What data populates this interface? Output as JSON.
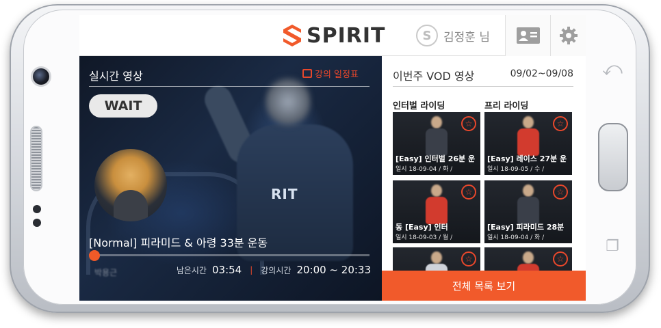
{
  "header": {
    "logo_text": "SPIRIT",
    "user_name": "김정훈 님",
    "accent_color": "#f15a2b",
    "icons": [
      "spirit-logo-icon",
      "user-avatar-icon",
      "id-card-icon",
      "gear-icon"
    ]
  },
  "live": {
    "title": "실시간 영상",
    "schedule_link": "강의 일정표",
    "status_badge": "WAIT",
    "program_title": "[Normal] 피라미드 & 아령 33분 운동",
    "progress_fraction": 0.02,
    "caption": "박용근",
    "remaining_label": "남은시간",
    "remaining_value": "03:54",
    "separator": "|",
    "class_time_label": "강의시간",
    "class_time_value": "20:00 ~ 20:33"
  },
  "vod": {
    "title": "이번주 VOD 영상",
    "date_range": "09/02~09/08",
    "categories": [
      "인터벌 라이딩",
      "프리 라이딩"
    ],
    "tiles": [
      {
        "title": "[Easy] 인터벌 26분 운",
        "meta": "일시 18-09-04 / 화 /",
        "shirt": "#3a3f49"
      },
      {
        "title": "[Easy] 레이스 27분 운",
        "meta": "일시 18-09-05 / 수 /",
        "shirt": "#d23b2e"
      },
      {
        "title": "동    [Easy] 인터",
        "meta": "일시 18-09-03 / 월 /",
        "shirt": "#d23b2e"
      },
      {
        "title": "[Easy] 피라미드 28분",
        "meta": "일시 18-09-04 / 화 /",
        "shirt": "#3a3f49"
      },
      {
        "title": "",
        "meta": "",
        "shirt": "#cfd3da"
      },
      {
        "title": "",
        "meta": "",
        "shirt": "#d23b2e"
      }
    ],
    "all_list_button": "전체 목록 보기"
  }
}
